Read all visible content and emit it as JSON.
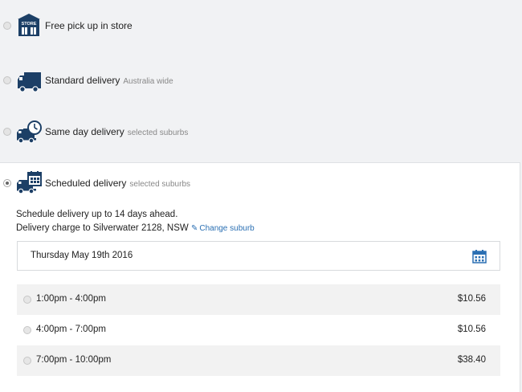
{
  "delivery_options": [
    {
      "label": "Free pick up in store",
      "sub": "",
      "icon": "store-icon",
      "selected": false
    },
    {
      "label": "Standard delivery",
      "sub": "Australia wide",
      "icon": "truck-icon",
      "selected": false
    },
    {
      "label": "Same day delivery",
      "sub": "selected suburbs",
      "icon": "truck-clock-icon",
      "selected": false
    },
    {
      "label": "Scheduled delivery",
      "sub": "selected suburbs",
      "icon": "truck-calendar-icon",
      "selected": true
    }
  ],
  "store_badge_text": "STORE",
  "scheduled": {
    "line1": "Schedule delivery up to 14 days ahead.",
    "line2": "Delivery charge to Silverwater 2128, NSW",
    "change_link": "Change suburb",
    "date": "Thursday May 19th 2016",
    "slots": [
      {
        "time": "1:00pm - 4:00pm",
        "price": "$10.56"
      },
      {
        "time": "4:00pm - 7:00pm",
        "price": "$10.56"
      },
      {
        "time": "7:00pm - 10:00pm",
        "price": "$38.40"
      }
    ]
  },
  "colors": {
    "icon": "#1c3f66",
    "link": "#2a6fb3",
    "background": "#f1f2f4",
    "panel": "#ffffff"
  }
}
